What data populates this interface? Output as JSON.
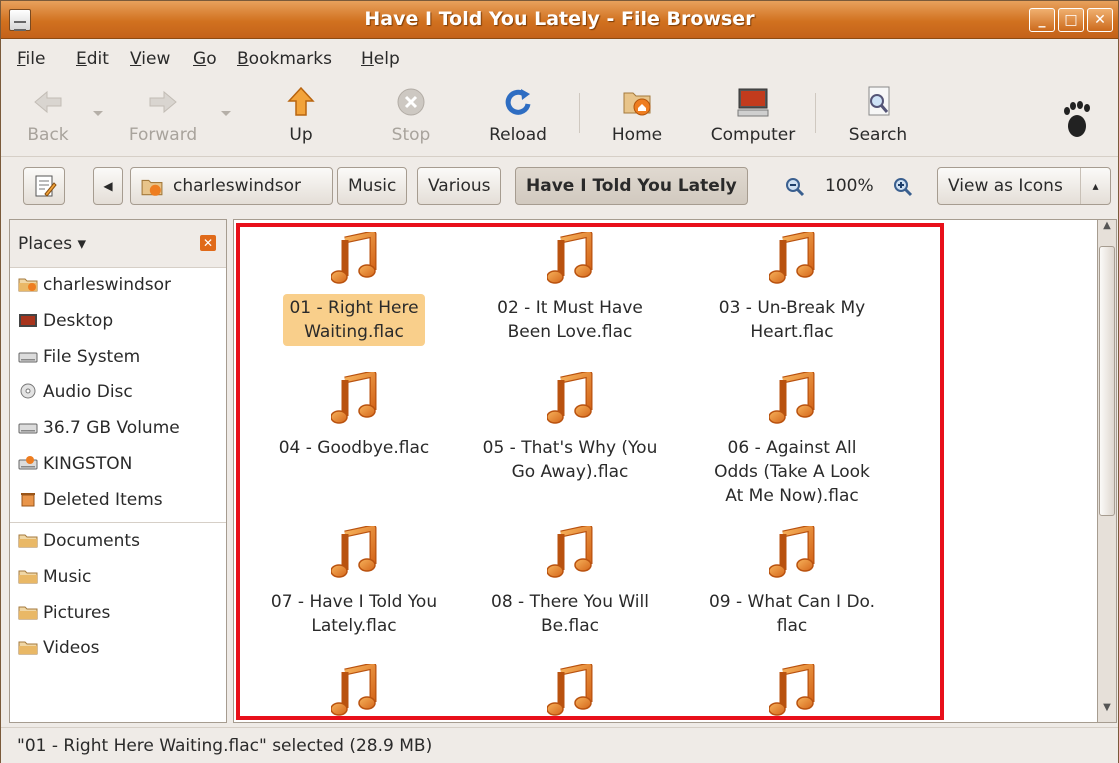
{
  "window": {
    "title": "Have I Told You Lately - File Browser"
  },
  "menu": [
    {
      "label": "File",
      "u": "F",
      "rest": "ile"
    },
    {
      "label": "Edit",
      "u": "E",
      "rest": "dit"
    },
    {
      "label": "View",
      "u": "V",
      "rest": "iew"
    },
    {
      "label": "Go",
      "u": "G",
      "rest": "o"
    },
    {
      "label": "Bookmarks",
      "u": "B",
      "rest": "ookmarks"
    },
    {
      "label": "Help",
      "u": "H",
      "rest": "elp"
    }
  ],
  "toolbar": {
    "back": "Back",
    "forward": "Forward",
    "up": "Up",
    "stop": "Stop",
    "reload": "Reload",
    "home": "Home",
    "computer": "Computer",
    "search": "Search"
  },
  "path": {
    "home": "charleswindsor",
    "crumbs": [
      "Music",
      "Various",
      "Have I Told You Lately"
    ],
    "zoom": "100%",
    "view_mode": "View as Icons"
  },
  "sidebar": {
    "header": "Places",
    "places": [
      {
        "label": "charleswindsor",
        "icon": "home-folder-icon"
      },
      {
        "label": "Desktop",
        "icon": "desktop-icon"
      },
      {
        "label": "File System",
        "icon": "harddisk-icon"
      },
      {
        "label": "Audio Disc",
        "icon": "cd-icon"
      },
      {
        "label": "36.7 GB Volume",
        "icon": "harddisk-icon"
      },
      {
        "label": "KINGSTON",
        "icon": "usb-drive-icon"
      },
      {
        "label": "Deleted Items",
        "icon": "trash-icon"
      }
    ],
    "bookmarks": [
      {
        "label": "Documents",
        "icon": "folder-icon"
      },
      {
        "label": "Music",
        "icon": "folder-icon"
      },
      {
        "label": "Pictures",
        "icon": "folder-icon"
      },
      {
        "label": "Videos",
        "icon": "folder-icon"
      }
    ]
  },
  "files": [
    {
      "line1": "01 - Right Here",
      "line2": "Waiting.flac",
      "line3": "",
      "selected": true
    },
    {
      "line1": "02 - It Must Have",
      "line2": "Been Love.flac",
      "line3": ""
    },
    {
      "line1": "03 - Un-Break My",
      "line2": "Heart.flac",
      "line3": ""
    },
    {
      "line1": "04 - Goodbye.flac",
      "line2": "",
      "line3": ""
    },
    {
      "line1": "05 - That's Why (You",
      "line2": "Go Away).flac",
      "line3": ""
    },
    {
      "line1": "06 - Against All",
      "line2": "Odds (Take A Look",
      "line3": "At Me Now).flac"
    },
    {
      "line1": "07 - Have I Told You",
      "line2": "Lately.flac",
      "line3": ""
    },
    {
      "line1": "08 - There You Will",
      "line2": "Be.flac",
      "line3": ""
    },
    {
      "line1": "09 - What Can I Do.",
      "line2": "flac",
      "line3": ""
    }
  ],
  "status": "\"01 - Right Here Waiting.flac\" selected (28.9 MB)",
  "colors": {
    "accent": "#e06a1a",
    "selection": "#f9cf8b",
    "highlight_box": "#e8101a"
  }
}
